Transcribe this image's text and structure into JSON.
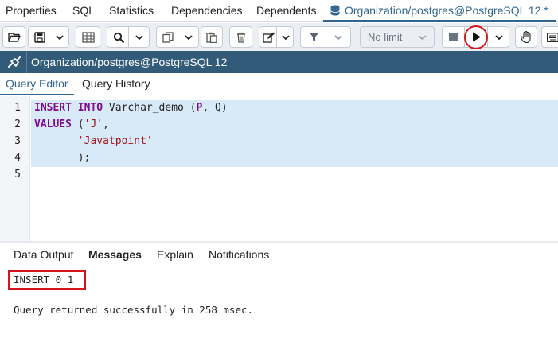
{
  "tabs": [
    {
      "label": "Properties"
    },
    {
      "label": "SQL"
    },
    {
      "label": "Statistics"
    },
    {
      "label": "Dependencies"
    },
    {
      "label": "Dependents"
    },
    {
      "label": "Organization/postgres@PostgreSQL 12 *",
      "active": true,
      "icon": "database-icon"
    }
  ],
  "toolbar": {
    "limit_label": "No limit",
    "icons": [
      "open-folder-icon",
      "save-icon",
      "chevron-down-icon",
      "save-data-icon",
      "search-icon",
      "copy-icon",
      "paste-icon",
      "delete-icon",
      "edit-icon",
      "filter-icon",
      "stop-icon",
      "execute-icon",
      "hand-icon",
      "keyboard-icon"
    ]
  },
  "connection": {
    "label": "Organization/postgres@PostgreSQL 12",
    "icon": "plug-icon"
  },
  "editor_tabs": [
    {
      "label": "Query Editor",
      "active": true
    },
    {
      "label": "Query History"
    }
  ],
  "code": {
    "line_numbers": [
      "1",
      "2",
      "3",
      "4",
      "5"
    ],
    "lines": [
      {
        "kw1": "INSERT",
        "sp1": " ",
        "kw2": "INTO",
        "rest": " Varchar_demo (",
        "kw3": "P",
        "tail": ", Q)"
      },
      {
        "kw1": "VALUES",
        "rest": " (",
        "str": "'J'",
        "tail": ","
      },
      {
        "indent": "       ",
        "str": "'Javatpoint'"
      },
      {
        "indent": "       ",
        "tail": ");"
      },
      {}
    ]
  },
  "output_tabs": [
    {
      "label": "Data Output"
    },
    {
      "label": "Messages",
      "active": true
    },
    {
      "label": "Explain"
    },
    {
      "label": "Notifications"
    }
  ],
  "messages": {
    "result": "INSERT 0 1",
    "status": "Query returned successfully in 258 msec."
  },
  "colors": {
    "accent": "#326690",
    "connection_bar": "#325b7a",
    "highlight": "#d2161b",
    "keyword": "#7f0b8f",
    "string": "#a3151a",
    "selection": "#d8eaf8"
  }
}
